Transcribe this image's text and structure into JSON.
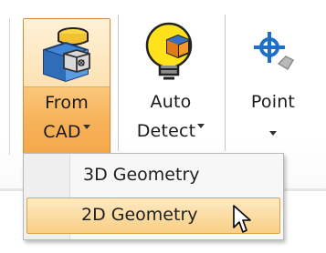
{
  "ribbon": {
    "buttons": [
      {
        "id": "from-cad",
        "line1": "From",
        "line2": "CAD",
        "icon": "cad-import-icon",
        "active": true
      },
      {
        "id": "auto-detect",
        "line1": "Auto",
        "line2": "Detect",
        "icon": "auto-detect-bulb-icon"
      },
      {
        "id": "point",
        "line1": "Point",
        "icon": "point-crosshair-icon"
      }
    ]
  },
  "dropdown": {
    "items": [
      {
        "label": "3D Geometry",
        "highlighted": false
      },
      {
        "label": "2D Geometry",
        "highlighted": true
      }
    ]
  },
  "colors": {
    "active_orange": "#f4a84a",
    "highlight_fill": "#fbdca2",
    "highlight_border": "#e0a44b",
    "point_icon_blue": "#1f6fc8"
  }
}
